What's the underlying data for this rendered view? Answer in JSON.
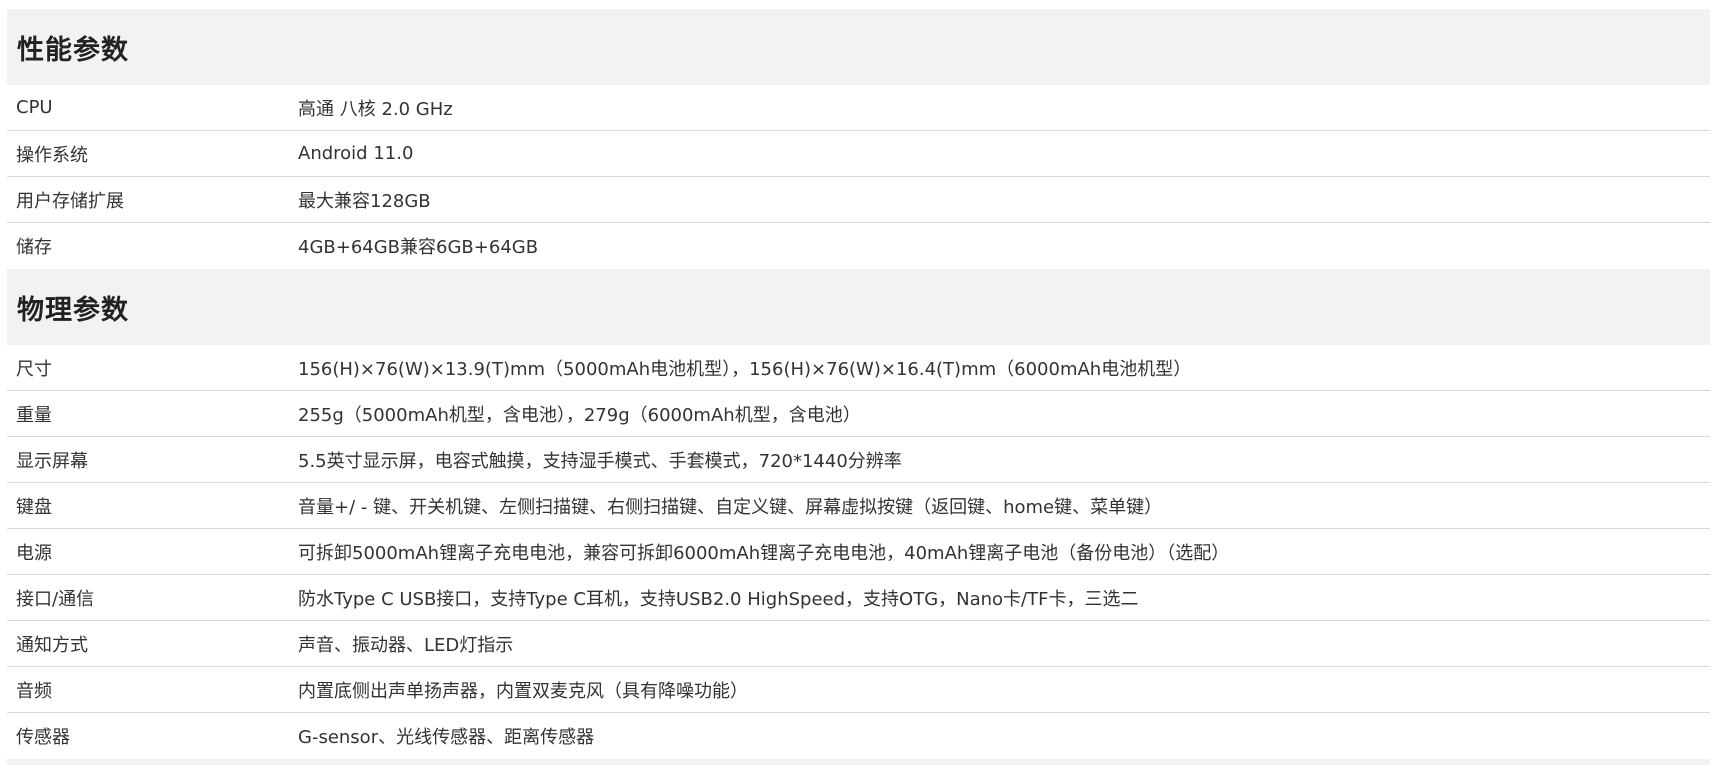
{
  "sections": [
    {
      "title": "性能参数",
      "rows": [
        {
          "label": "CPU",
          "value": "高通 八核 2.0 GHz"
        },
        {
          "label": "操作系统",
          "value": "Android 11.0"
        },
        {
          "label": "用户存储扩展",
          "value": "最大兼容128GB"
        },
        {
          "label": "储存",
          "value": "4GB+64GB兼容6GB+64GB"
        }
      ]
    },
    {
      "title": "物理参数",
      "rows": [
        {
          "label": "尺寸",
          "value": "156(H)×76(W)×13.9(T)mm（5000mAh电池机型），156(H)×76(W)×16.4(T)mm（6000mAh电池机型）"
        },
        {
          "label": "重量",
          "value": "255g（5000mAh机型，含电池），279g（6000mAh机型，含电池）"
        },
        {
          "label": "显示屏幕",
          "value": "5.5英寸显示屏，电容式触摸，支持湿手模式、手套模式，720*1440分辨率"
        },
        {
          "label": "键盘",
          "value": "音量+/ - 键、开关机键、左侧扫描键、右侧扫描键、自定义键、屏幕虚拟按键（返回键、home键、菜单键）"
        },
        {
          "label": "电源",
          "value": "可拆卸5000mAh锂离子充电电池，兼容可拆卸6000mAh锂离子充电电池，40mAh锂离子电池（备份电池）（选配）"
        },
        {
          "label": "接口/通信",
          "value": "防水Type C USB接口，支持Type C耳机，支持USB2.0 HighSpeed，支持OTG，Nano卡/TF卡，三选二"
        },
        {
          "label": "通知方式",
          "value": "声音、振动器、LED灯指示"
        },
        {
          "label": "音频",
          "value": "内置底侧出声单扬声器，内置双麦克风（具有降噪功能）"
        },
        {
          "label": "传感器",
          "value": "G-sensor、光线传感器、距离传感器"
        }
      ]
    }
  ]
}
